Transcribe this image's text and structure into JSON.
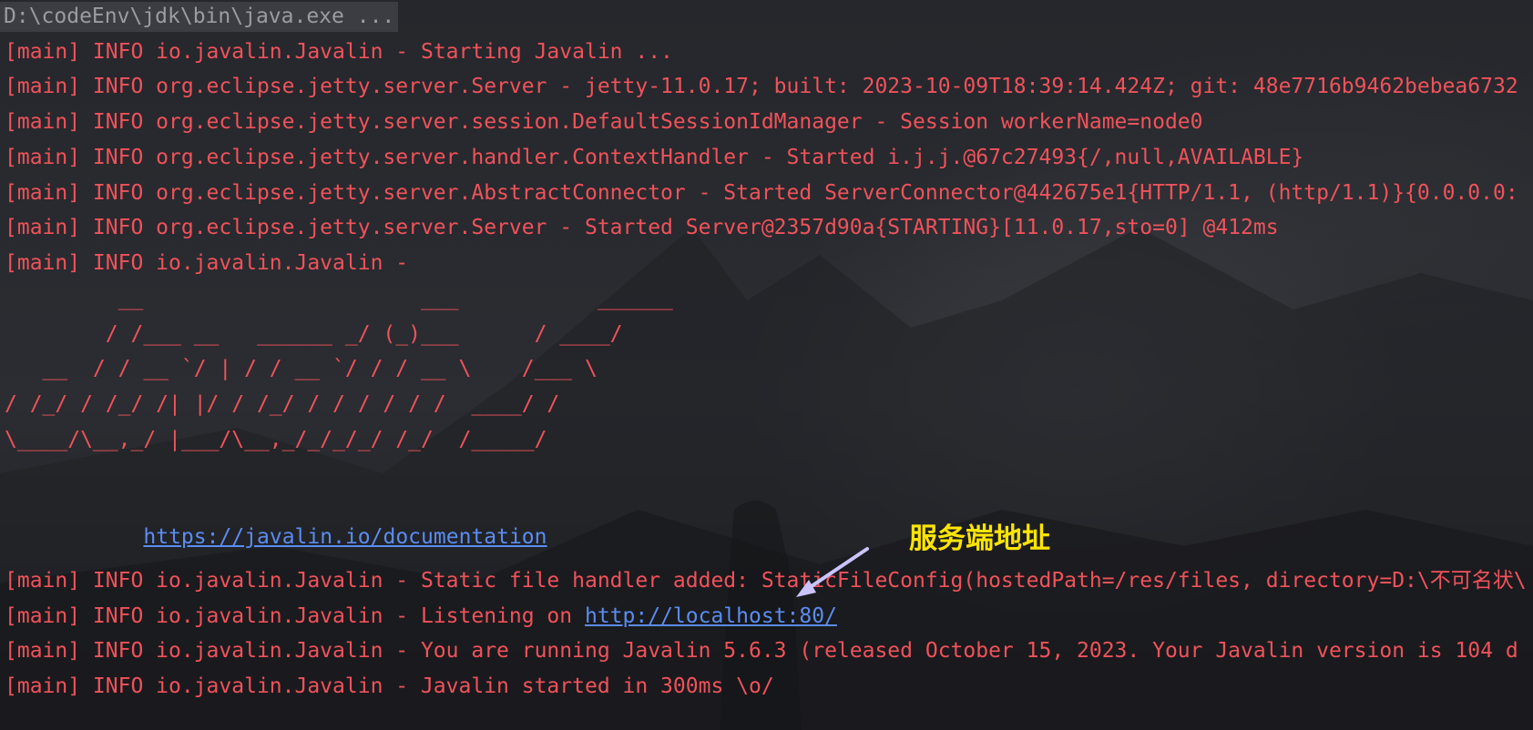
{
  "command": "D:\\codeEnv\\jdk\\bin\\java.exe ...",
  "log_lines_top": [
    "[main] INFO io.javalin.Javalin - Starting Javalin ...",
    "[main] INFO org.eclipse.jetty.server.Server - jetty-11.0.17; built: 2023-10-09T18:39:14.424Z; git: 48e7716b9462bebea6732",
    "[main] INFO org.eclipse.jetty.server.session.DefaultSessionIdManager - Session workerName=node0",
    "[main] INFO org.eclipse.jetty.server.handler.ContextHandler - Started i.j.j.@67c27493{/,null,AVAILABLE}",
    "[main] INFO org.eclipse.jetty.server.AbstractConnector - Started ServerConnector@442675e1{HTTP/1.1, (http/1.1)}{0.0.0.0:",
    "[main] INFO org.eclipse.jetty.server.Server - Started Server@2357d90a{STARTING}[11.0.17,sto=0] @412ms",
    "[main] INFO io.javalin.Javalin - "
  ],
  "ascii_art": [
    "         __                      ___           ______",
    "        / /___ __   ______ _/ (_)___      / ____/",
    "   __  / / __ `/ | / / __ `/ / / __ \\    /___ \\",
    "/ /_/ / /_/ /| |/ / /_/ / / / / / /  ____/ /",
    "\\____/\\__,_/ |___/\\__,_/_/_/_/ /_/  /_____/"
  ],
  "doc_link": "https://javalin.io/documentation",
  "log_static": "[main] INFO io.javalin.Javalin - Static file handler added: StaticFileConfig(hostedPath=/res/files, directory=D:\\不可名状\\",
  "log_listening_prefix": "[main] INFO io.javalin.Javalin - Listening on ",
  "listening_url": "http://localhost:80/",
  "log_version": "[main] INFO io.javalin.Javalin - You are running Javalin 5.6.3 (released October 15, 2023. Your Javalin version is 104 d",
  "log_started": "[main] INFO io.javalin.Javalin - Javalin started in 300ms \\o/",
  "annotation_label": "服务端地址",
  "colors": {
    "log_text": "#f0525a",
    "link": "#5b8cf0",
    "annotation": "#ffe500",
    "command_bg": "#3b3d42",
    "background": "#23252b"
  }
}
